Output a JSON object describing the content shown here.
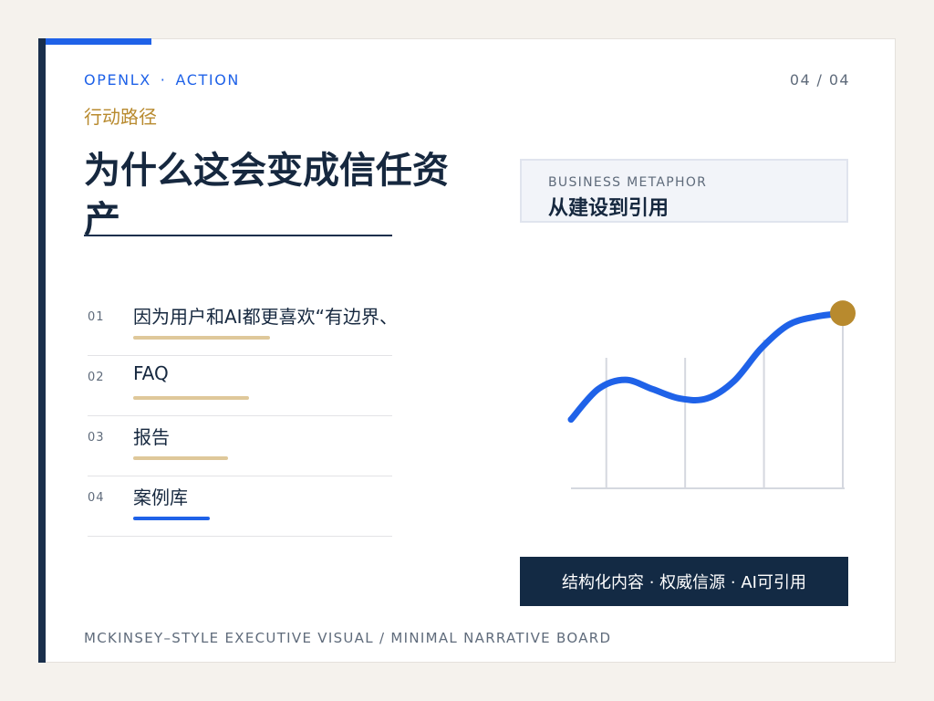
{
  "header": {
    "brand_left": "OPENLX",
    "brand_dot": "·",
    "brand_right": "ACTION",
    "section_label": "行动路径",
    "page_indicator": "04 / 04"
  },
  "title": "为什么这会变成信任资产",
  "steps": [
    {
      "num": "01",
      "label": "因为用户和AI都更喜欢“有边界、",
      "bar_fraction": 0.45,
      "bar_color": "#dfc89a"
    },
    {
      "num": "02",
      "label": "FAQ",
      "bar_fraction": 0.38,
      "bar_color": "#dfc89a"
    },
    {
      "num": "03",
      "label": "报告",
      "bar_fraction": 0.31,
      "bar_color": "#dfc89a"
    },
    {
      "num": "04",
      "label": "案例库",
      "bar_fraction": 0.25,
      "bar_color": "#1f62e8"
    }
  ],
  "metaphor": {
    "kicker": "BUSINESS METAPHOR",
    "heading": "从建设到引用"
  },
  "chart_data": {
    "type": "line",
    "series_color": "#1f62e8",
    "endpoint_color": "#b88a2e",
    "x": [
      0,
      1,
      2,
      3,
      4,
      5,
      6,
      7,
      8,
      9,
      10
    ],
    "y": [
      0.12,
      0.38,
      0.46,
      0.38,
      0.3,
      0.3,
      0.45,
      0.73,
      0.93,
      1.0,
      1.03
    ],
    "grid_x": [
      1.3,
      4.2,
      7.1,
      10
    ]
  },
  "tagline": "结构化内容 · 权威信源 · AI可引用",
  "footer": "MCKINSEY–STYLE EXECUTIVE VISUAL / MINIMAL NARRATIVE BOARD",
  "colors": {
    "accent_blue": "#1f62e8",
    "navy": "#1a2f4c",
    "gold": "#b88a2e",
    "background": "#f5f2ed"
  }
}
